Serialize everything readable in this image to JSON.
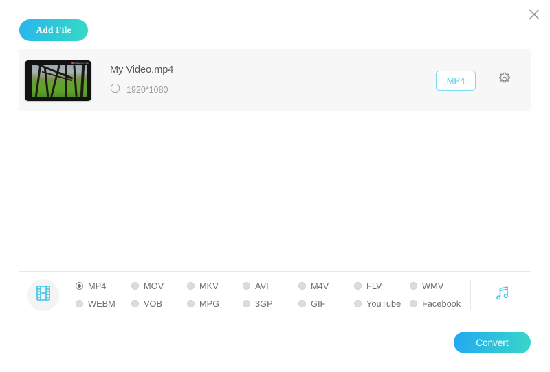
{
  "window": {
    "close_icon": "close-icon"
  },
  "toolbar": {
    "add_file_label": "Add File"
  },
  "file_list": {
    "items": [
      {
        "name": "My Video.mp4",
        "info_icon": "info-circle-icon",
        "resolution": "1920*1080",
        "output_format": "MP4",
        "settings_icon": "gear-icon",
        "thumbnail": "video-thumbnail-forest"
      }
    ]
  },
  "format_panel": {
    "video_icon": "film-strip-icon",
    "audio_icon": "music-note-icon",
    "selected_format": "MP4",
    "formats": [
      {
        "label": "MP4",
        "checked": true
      },
      {
        "label": "MOV",
        "checked": false
      },
      {
        "label": "MKV",
        "checked": false
      },
      {
        "label": "AVI",
        "checked": false
      },
      {
        "label": "M4V",
        "checked": false
      },
      {
        "label": "FLV",
        "checked": false
      },
      {
        "label": "WMV",
        "checked": false
      },
      {
        "label": "WEBM",
        "checked": false
      },
      {
        "label": "VOB",
        "checked": false
      },
      {
        "label": "MPG",
        "checked": false
      },
      {
        "label": "3GP",
        "checked": false
      },
      {
        "label": "GIF",
        "checked": false
      },
      {
        "label": "YouTube",
        "checked": false
      },
      {
        "label": "Facebook",
        "checked": false
      }
    ]
  },
  "actions": {
    "convert_label": "Convert"
  },
  "colors": {
    "accent_cyan": "#5ecbe8",
    "gradient_start": "#23a8f2",
    "gradient_end": "#3ad6c6",
    "row_background": "#f7f7f7"
  }
}
